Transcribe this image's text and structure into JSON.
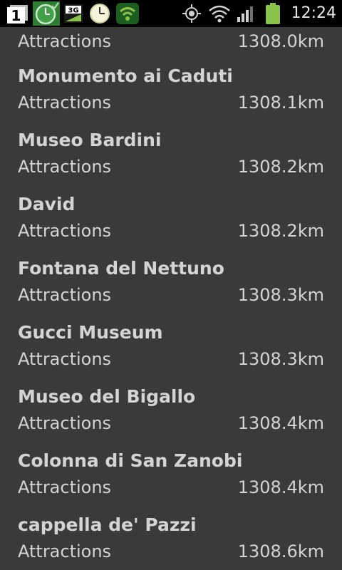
{
  "status_bar": {
    "time": "12:24",
    "notification_count": "1",
    "network_type": "3G",
    "icons": [
      "notification-count-icon",
      "clock-app-icon",
      "3g-data-icon",
      "clock-icon",
      "shield-wifi-icon",
      "gps-icon",
      "wifi-icon",
      "signal-icon",
      "battery-icon"
    ]
  },
  "list": {
    "partial_top": {
      "category": "Attractions",
      "distance": "1308.0km"
    },
    "items": [
      {
        "name": "Monumento ai Caduti",
        "category": "Attractions",
        "distance": "1308.1km"
      },
      {
        "name": "Museo Bardini",
        "category": "Attractions",
        "distance": "1308.2km"
      },
      {
        "name": "David",
        "category": "Attractions",
        "distance": "1308.2km"
      },
      {
        "name": "Fontana del Nettuno",
        "category": "Attractions",
        "distance": "1308.3km"
      },
      {
        "name": "Gucci Museum",
        "category": "Attractions",
        "distance": "1308.3km"
      },
      {
        "name": "Museo del Bigallo",
        "category": "Attractions",
        "distance": "1308.4km"
      },
      {
        "name": "Colonna di San Zanobi",
        "category": "Attractions",
        "distance": "1308.4km"
      },
      {
        "name": "cappella de' Pazzi",
        "category": "Attractions",
        "distance": "1308.6km"
      }
    ]
  }
}
